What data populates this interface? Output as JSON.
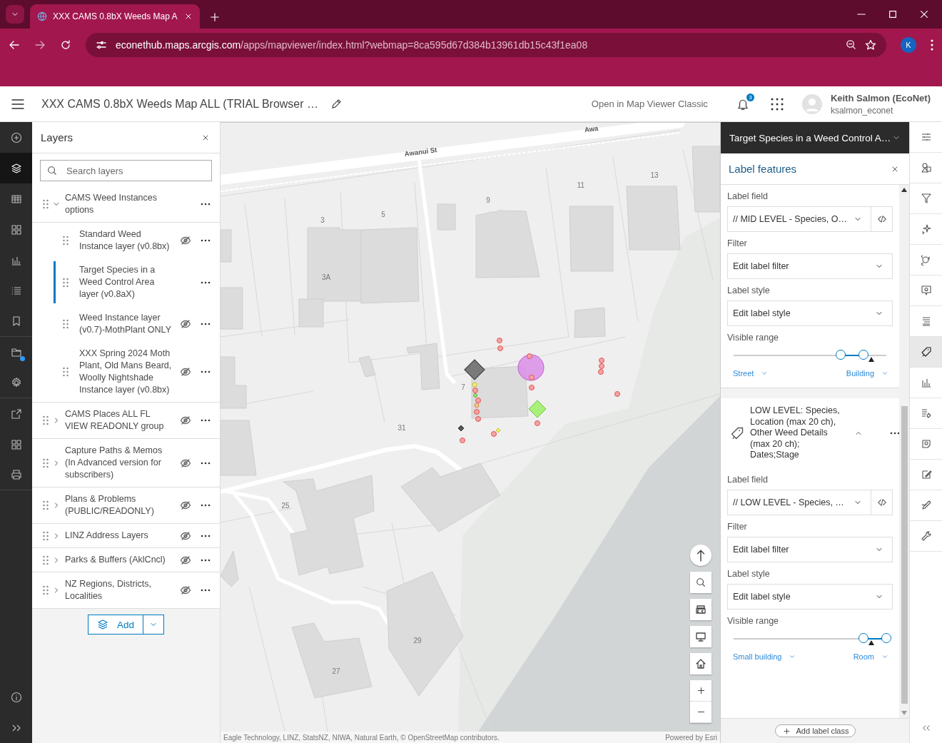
{
  "browser": {
    "tab_title": "XXX CAMS 0.8bX Weeds Map A",
    "url_host": "econethub.maps.arcgis.com",
    "url_path": "/apps/mapviewer/index.html?webmap=8ca595d67d384b13961db15c43f1ea08",
    "profile_initial": "K"
  },
  "header": {
    "title": "XXX CAMS 0.8bX Weeds Map ALL (TRIAL Browser …",
    "classic_link": "Open in Map Viewer Classic",
    "notification_count": "3",
    "user_name": "Keith Salmon (EcoNet)",
    "user_id": "ksalmon_econet"
  },
  "left_rail": [
    {
      "kind": "add",
      "selected": false
    },
    {
      "kind": "layers",
      "selected": true
    },
    {
      "kind": "table",
      "selected": false
    },
    {
      "kind": "widgets",
      "selected": false
    },
    {
      "kind": "charts",
      "selected": false
    },
    {
      "kind": "legend",
      "selected": false
    },
    {
      "kind": "bookmarks",
      "selected": false
    },
    {
      "kind": "folder",
      "selected": false,
      "badge": true
    },
    {
      "kind": "settings",
      "selected": false
    },
    {
      "kind": "share",
      "selected": false
    },
    {
      "kind": "apps",
      "selected": false
    },
    {
      "kind": "print",
      "selected": false
    }
  ],
  "left_rail_bottom": [
    {
      "kind": "info"
    },
    {
      "kind": "expand"
    }
  ],
  "layers_panel": {
    "title": "Layers",
    "search": {
      "placeholder": "Search layers"
    },
    "layers": [
      {
        "title": "CAMS Weed Instances options",
        "visible": true,
        "selected": false,
        "expanded": true,
        "children": [
          {
            "title": "Standard Weed Instance layer (v0.8bx)",
            "visible": false,
            "selected": false
          },
          {
            "title": "Target Species in a Weed Control Area layer (v0.8aX)",
            "visible": true,
            "selected": true
          },
          {
            "title": "Weed Instance layer (v0.7)-MothPlant ONLY",
            "visible": false,
            "selected": false
          },
          {
            "title": "XXX Spring 2024 Moth Plant, Old Mans Beard, Woolly Nightshade Instance layer (v0.8bx)",
            "visible": false,
            "selected": false
          }
        ]
      },
      {
        "title": "CAMS Places ALL FL VIEW READONLY group",
        "visible": false,
        "selected": false,
        "expanded": false
      },
      {
        "title": "Capture Paths & Memos (In Advanced version for subscribers)",
        "visible": false,
        "selected": false,
        "expanded": false
      },
      {
        "title": "Plans & Problems (PUBLIC/READONLY)",
        "visible": false,
        "selected": false,
        "expanded": false
      },
      {
        "title": "LINZ Address Layers",
        "visible": false,
        "selected": false,
        "expanded": false
      },
      {
        "title": "Parks & Buffers (AklCncl)",
        "visible": false,
        "selected": false,
        "expanded": false
      },
      {
        "title": "NZ Regions, Districts, Localities",
        "visible": false,
        "selected": false,
        "expanded": false
      }
    ],
    "add_button": "Add"
  },
  "map": {
    "labels": [
      {
        "kind": "street",
        "text": "Awanui St"
      },
      {
        "kind": "street",
        "text": "Awa"
      },
      {
        "kind": "number",
        "text": "3"
      },
      {
        "kind": "number",
        "text": "5"
      },
      {
        "kind": "number",
        "text": "9"
      },
      {
        "kind": "number",
        "text": "11"
      },
      {
        "kind": "number",
        "text": "13"
      },
      {
        "kind": "number",
        "text": "3A"
      },
      {
        "kind": "number",
        "text": "7"
      },
      {
        "kind": "number",
        "text": "31"
      },
      {
        "kind": "number",
        "text": "25"
      },
      {
        "kind": "number",
        "text": "29"
      },
      {
        "kind": "number",
        "text": "27"
      }
    ],
    "attribution": "Eagle Technology, LINZ, StatsNZ, NIWA, Natural Earth, © OpenStreetMap contributors.",
    "powered_by": "Powered by Esri"
  },
  "properties_panel": {
    "layer_title": "Target Species in a Weed Control A…",
    "title": "Label features",
    "label_classes": [
      {
        "label_field": {
          "label": "Label field",
          "value": "// MID LEVEL - Species, O…"
        },
        "filter": {
          "label": "Filter",
          "value": "Edit label filter"
        },
        "style": {
          "label": "Label style",
          "value": "Edit label style"
        },
        "range": {
          "label": "Visible range",
          "min_thumb": {
            "level": 0.7
          },
          "max_thumb": {
            "level": 0.85
          },
          "current_scale": {
            "level": 0.9
          },
          "min_scale": "Street",
          "max_scale": "Building"
        }
      },
      {
        "title": "LOW LEVEL: Species, Location (max 20 ch), Other Weed Details (max 20 ch); Dates;Stage",
        "expanded": true,
        "label_field": {
          "label": "Label field",
          "value": "// LOW LEVEL - Species, …"
        },
        "filter": {
          "label": "Filter",
          "value": "Edit label filter"
        },
        "style": {
          "label": "Label style",
          "value": "Edit label style"
        },
        "range": {
          "label": "Visible range",
          "min_thumb": {
            "level": 0.85
          },
          "max_thumb": {
            "level": 1
          },
          "current_scale": {
            "level": 0.9
          },
          "min_scale": "Small building",
          "max_scale": "Room"
        }
      }
    ],
    "add_class_button": "Add label class"
  },
  "right_rail": [
    {
      "kind": "properties",
      "selected": false
    },
    {
      "kind": "styles",
      "selected": false
    },
    {
      "kind": "filter",
      "selected": false
    },
    {
      "kind": "effects",
      "selected": false
    },
    {
      "kind": "clustering",
      "selected": false
    },
    {
      "kind": "popups",
      "selected": false
    },
    {
      "kind": "fields",
      "selected": false
    },
    {
      "kind": "labels",
      "selected": true
    },
    {
      "kind": "charts",
      "selected": false
    },
    {
      "kind": "forms",
      "selected": false
    },
    {
      "kind": "configure",
      "selected": false
    },
    {
      "kind": "edit",
      "selected": false
    },
    {
      "kind": "sketch",
      "selected": false
    },
    {
      "kind": "tools",
      "selected": false
    }
  ]
}
